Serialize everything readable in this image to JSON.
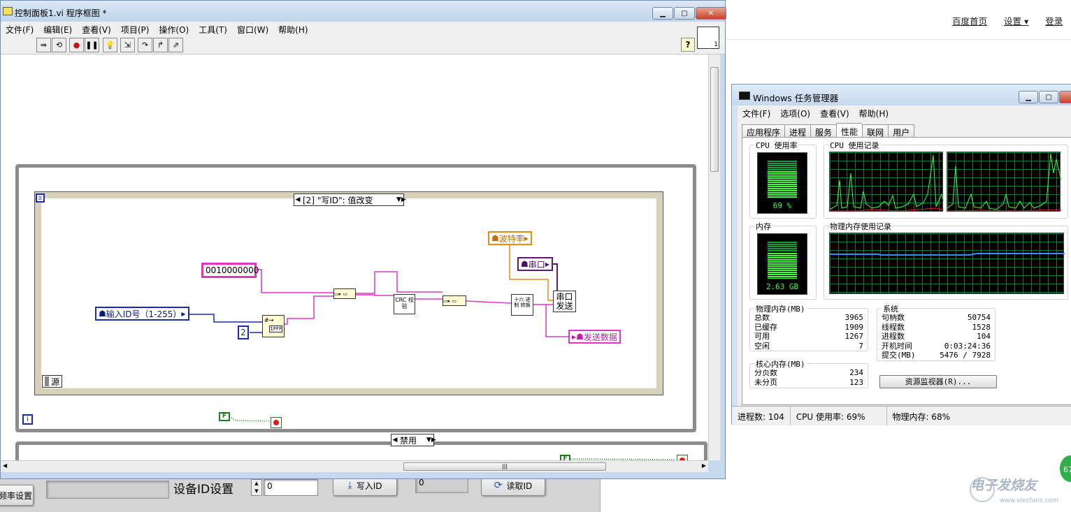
{
  "browser": {
    "links": [
      "百度首页",
      "设置",
      "登录"
    ],
    "watermark": "电子发烧友",
    "watermark_url": "www.elecfans.com",
    "badge": "67"
  },
  "front_panel": {
    "left_button": "频率设置",
    "device_id_label": "设备ID设置",
    "id_value": "0",
    "write_button": "写入ID",
    "read_value": "0",
    "read_button": "读取ID"
  },
  "labview": {
    "title": "控制面板1.vi 程序框图 *",
    "menu": [
      "文件(F)",
      "编辑(E)",
      "查看(V)",
      "项目(P)",
      "操作(O)",
      "工具(T)",
      "窗口(W)",
      "帮助(H)"
    ],
    "toolbar_icons": [
      "run-continuously-icon",
      "retain-wire-values-icon",
      "abort-icon",
      "pause-icon",
      "highlight-execution-icon",
      "step-into-icon",
      "step-over-icon",
      "step-out-icon",
      "clean-up-icon"
    ],
    "help_label": "?",
    "diagram": {
      "event_case_label": "[2] \"写ID\": 值改变",
      "disabled_case_label": "禁用",
      "source_label": "源",
      "loop_index": "i",
      "constant_hex": "0010000000",
      "input_id_control": "输入ID号（1-255）",
      "constant_two": "2",
      "baud_rate": "波特率",
      "serial_port": "串口",
      "crc_node": "CRC 校验",
      "hex_convert_node": "十六 进制 转换",
      "serial_send_node": "串口 发送",
      "send_data_indicator": "发送数据",
      "bool_false": "F",
      "vi_icon_label": "1"
    }
  },
  "task_manager": {
    "title": "Windows 任务管理器",
    "menu": [
      "文件(F)",
      "选项(O)",
      "查看(V)",
      "帮助(H)"
    ],
    "tabs": [
      "应用程序",
      "进程",
      "服务",
      "性能",
      "联网",
      "用户"
    ],
    "active_tab": "性能",
    "cpu_usage_label": "CPU 使用率",
    "cpu_usage_value": "69 %",
    "cpu_usage_percent": 69,
    "cpu_history_label": "CPU 使用记录",
    "memory_label": "内存",
    "memory_value": "2.63 GB",
    "memory_percent": 68,
    "memory_history_label": "物理内存使用记录",
    "physical_memory": {
      "label": "物理内存(MB)",
      "rows": [
        {
          "name": "总数",
          "value": "3965"
        },
        {
          "name": "已缓存",
          "value": "1909"
        },
        {
          "name": "可用",
          "value": "1267"
        },
        {
          "name": "空闲",
          "value": "7"
        }
      ]
    },
    "kernel_memory": {
      "label": "核心内存(MB)",
      "rows": [
        {
          "name": "分页数",
          "value": "234"
        },
        {
          "name": "未分页",
          "value": "123"
        }
      ]
    },
    "system": {
      "label": "系统",
      "rows": [
        {
          "name": "句柄数",
          "value": "50754"
        },
        {
          "name": "线程数",
          "value": "1528"
        },
        {
          "name": "进程数",
          "value": "104"
        },
        {
          "name": "开机时间",
          "value": "0:03:24:36"
        },
        {
          "name": "提交(MB)",
          "value": "5476 / 7928"
        }
      ]
    },
    "resource_monitor_button": "资源监视器(R)...",
    "status": {
      "processes": "进程数: 104",
      "cpu": "CPU 使用率: 69%",
      "memory": "物理内存: 68%"
    }
  }
}
